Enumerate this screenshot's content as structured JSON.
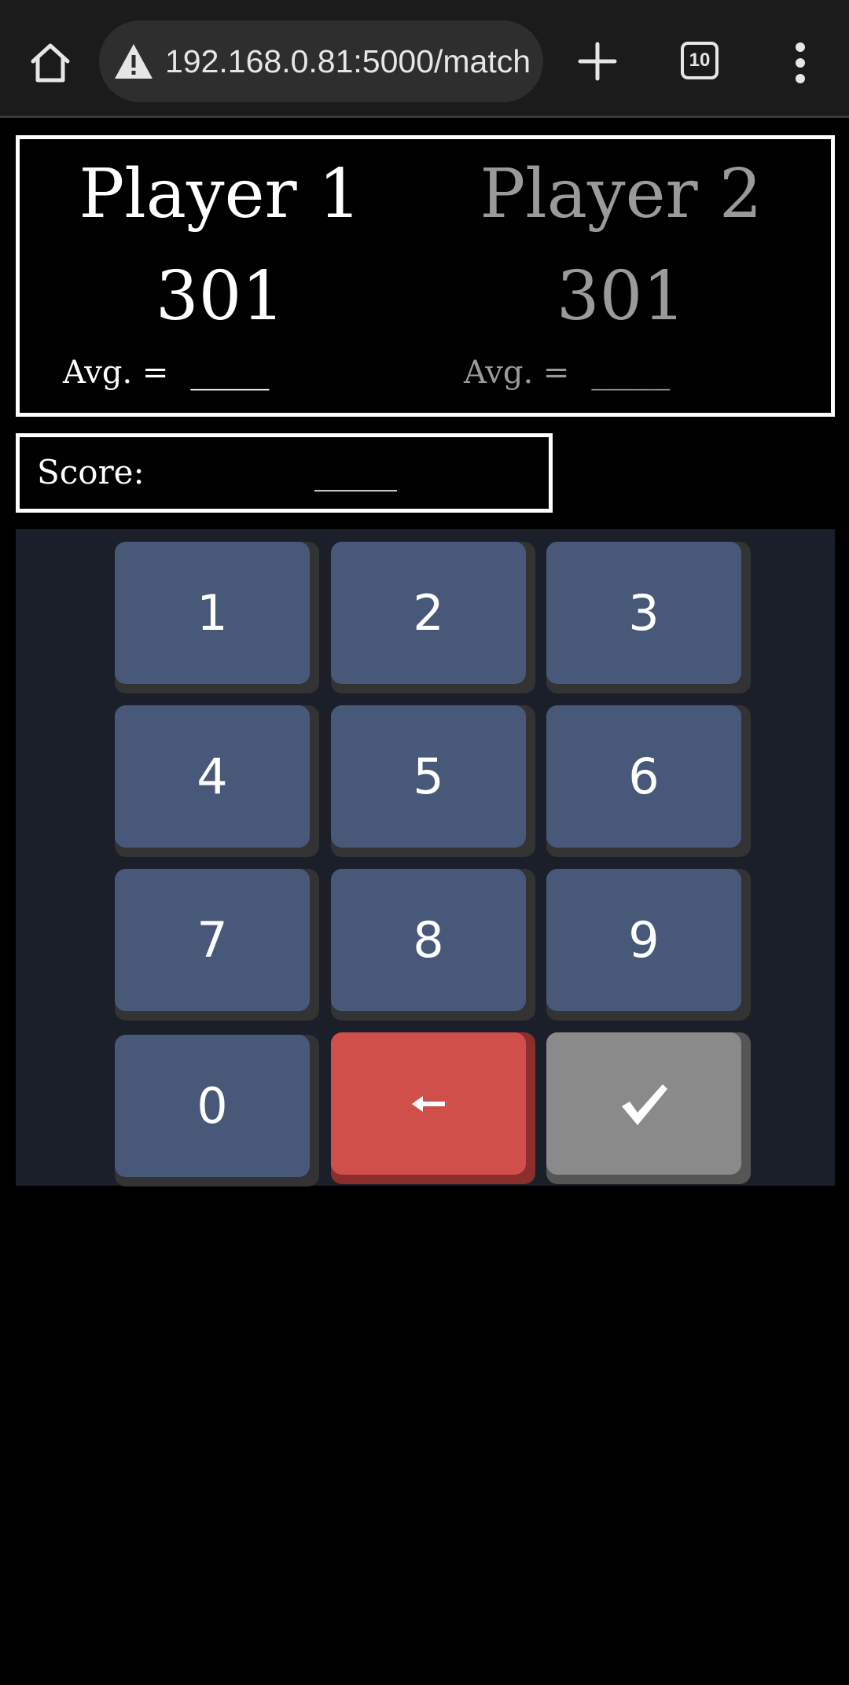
{
  "browser": {
    "url": "192.168.0.81:5000/match",
    "tab_count": "10",
    "icons": {
      "home": "home-icon",
      "warning": "warning-icon",
      "new_tab": "plus-icon",
      "menu": "more-vertical-icon"
    }
  },
  "players": [
    {
      "name": "Player 1",
      "score": "301",
      "avg_label": "Avg. =",
      "avg_value": "_____",
      "active": true
    },
    {
      "name": "Player 2",
      "score": "301",
      "avg_label": "Avg. =",
      "avg_value": "_____",
      "active": false
    }
  ],
  "score_input": {
    "label": "Score:",
    "value": "_____"
  },
  "keypad": {
    "digits": [
      "1",
      "2",
      "3",
      "4",
      "5",
      "6",
      "7",
      "8",
      "9",
      "0"
    ],
    "backspace_icon": "arrow-left-icon",
    "confirm_icon": "checkmark-icon"
  },
  "colors": {
    "active_text": "#ffffff",
    "inactive_text": "#9a9a9a",
    "key": "#475879",
    "backspace": "#d14f4a",
    "confirm": "#8a8a8a",
    "keypad_bg": "#1a1f29"
  }
}
